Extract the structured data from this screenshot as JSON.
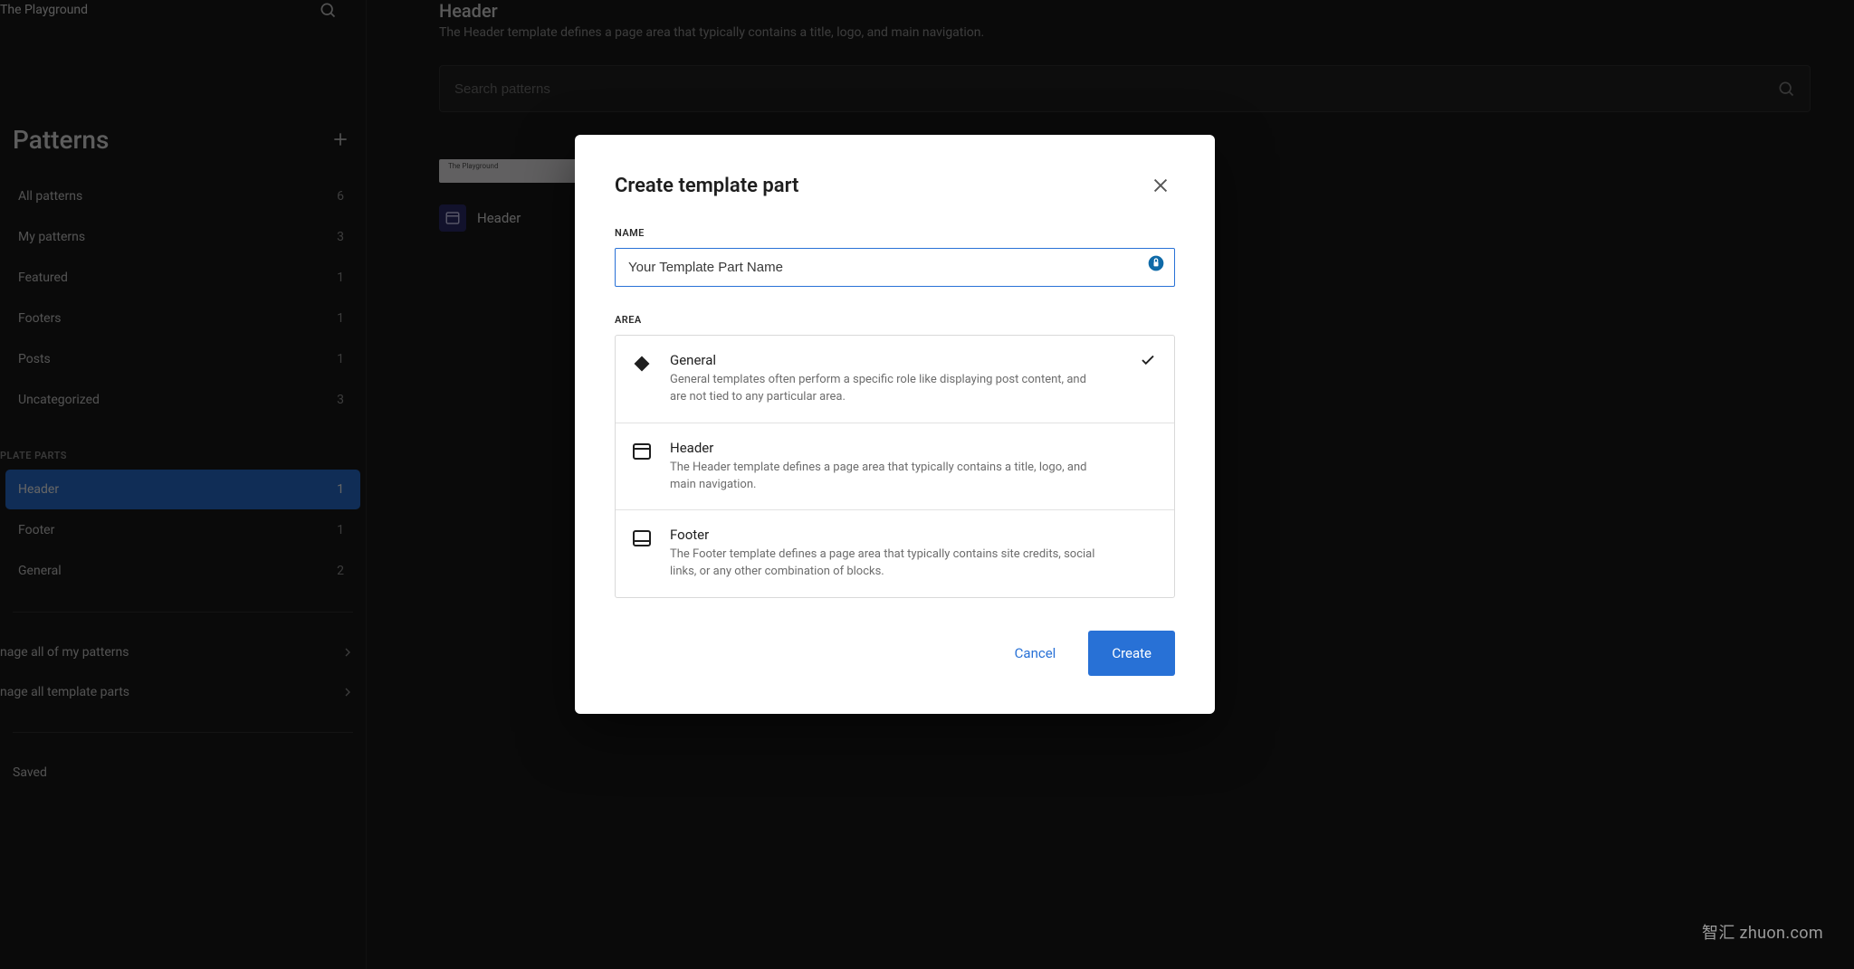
{
  "site": {
    "name": "The Playground"
  },
  "sidebar": {
    "title": "Patterns",
    "items": [
      {
        "label": "All patterns",
        "count": "6"
      },
      {
        "label": "My patterns",
        "count": "3"
      },
      {
        "label": "Featured",
        "count": "1"
      },
      {
        "label": "Footers",
        "count": "1"
      },
      {
        "label": "Posts",
        "count": "1"
      },
      {
        "label": "Uncategorized",
        "count": "3"
      }
    ],
    "parts_section_label": "PLATE PARTS",
    "parts": [
      {
        "label": "Header",
        "count": "1",
        "active": true
      },
      {
        "label": "Footer",
        "count": "1"
      },
      {
        "label": "General",
        "count": "2"
      }
    ],
    "manage": [
      {
        "label": "nage all of my patterns"
      },
      {
        "label": "nage all template parts"
      }
    ],
    "saved_label": "Saved"
  },
  "main": {
    "heading": "Header",
    "subtitle": "The Header template defines a page area that typically contains a title, logo, and main navigation.",
    "search_placeholder": "Search patterns",
    "card": {
      "thumb_text": "The Playground",
      "title": "Header"
    }
  },
  "modal": {
    "title": "Create template part",
    "name_label": "NAME",
    "name_value": "Your Template Part Name",
    "area_label": "AREA",
    "areas": [
      {
        "title": "General",
        "desc": "General templates often perform a specific role like displaying post content, and are not tied to any particular area.",
        "selected": true
      },
      {
        "title": "Header",
        "desc": "The Header template defines a page area that typically contains a title, logo, and main navigation."
      },
      {
        "title": "Footer",
        "desc": "The Footer template defines a page area that typically contains site credits, social links, or any other combination of blocks."
      }
    ],
    "cancel_label": "Cancel",
    "create_label": "Create"
  },
  "watermark": "智汇 zhuon.com"
}
